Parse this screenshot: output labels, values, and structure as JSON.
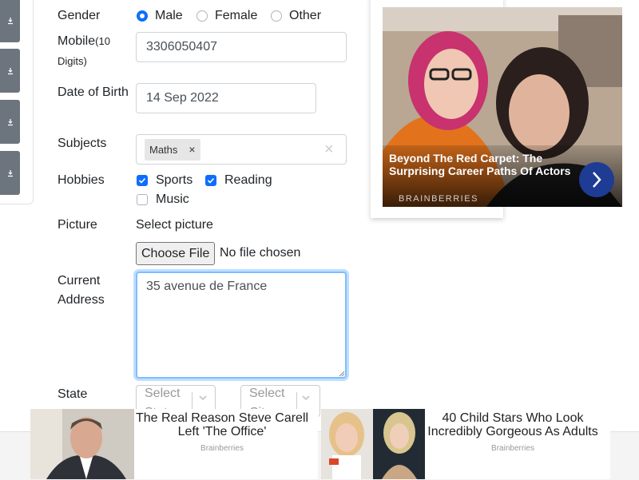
{
  "form": {
    "gender": {
      "label": "Gender",
      "options": [
        "Male",
        "Female",
        "Other"
      ],
      "selected": "Male"
    },
    "mobile": {
      "label": "Mobile",
      "hint": "(10 Digits)",
      "value": "3306050407"
    },
    "dob": {
      "label": "Date of Birth",
      "value": "14 Sep 2022"
    },
    "subjects": {
      "label": "Subjects",
      "chips": [
        "Maths"
      ],
      "clear": "×",
      "chip_remove": "×"
    },
    "hobbies": {
      "label": "Hobbies",
      "options": [
        {
          "label": "Sports",
          "checked": true
        },
        {
          "label": "Reading",
          "checked": true
        },
        {
          "label": "Music",
          "checked": false
        }
      ]
    },
    "picture": {
      "label": "Picture",
      "select_text": "Select picture",
      "button": "Choose File",
      "status": "No file chosen"
    },
    "address": {
      "label": "Current Address",
      "value": "35 avenue de France"
    },
    "state": {
      "label": "State",
      "state_placeholder": "Select State",
      "city_placeholder": "Select City"
    }
  },
  "ad_right": {
    "title": "Beyond The Red Carpet: The Surprising Career Paths Of Actors",
    "brand": "BRAINBERRIES",
    "accent": "#1e3c94"
  },
  "ad_bottom": [
    {
      "title": "The Real Reason Steve Carell Left 'The Office'",
      "source": "Brainberries"
    },
    {
      "title": "40 Child Stars Who Look Incredibly Gorgeous As Adults",
      "source": "Brainberries"
    }
  ],
  "colors": {
    "primary": "#0d6efd",
    "sidebar_button": "#6c757d"
  },
  "icons": [
    "download-icon",
    "check-icon",
    "chevron-down-icon",
    "chevron-right-icon",
    "close-icon"
  ]
}
